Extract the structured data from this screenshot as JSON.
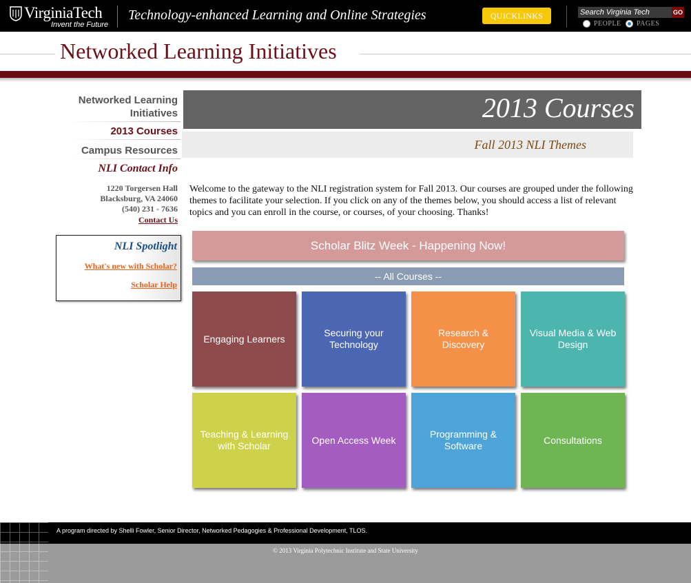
{
  "topbar": {
    "logo_text": "VirginiaTech",
    "logo_tagline": "Invent the Future",
    "site_title": "Technology-enhanced Learning and Online Strategies",
    "quicklinks_label": "QUICKLINKS",
    "search_placeholder": "Search Virginia Tech",
    "search_button": "GO",
    "radio_people": "PEOPLE",
    "radio_pages": "PAGES",
    "radio_selected": "PAGES"
  },
  "header": {
    "title": "Networked Learning Initiatives"
  },
  "sidebar": {
    "nav": [
      {
        "label_line1": "Networked Learning",
        "label_line2": "Initiatives",
        "color": "#555555"
      },
      {
        "label": "2013 Courses",
        "color": "#6a1018"
      },
      {
        "label": "Campus Resources",
        "color": "#555555"
      }
    ],
    "contact_heading": "NLI Contact Info",
    "address": [
      "1220 Torgersen Hall",
      "Blacksburg, VA 24060",
      "(540) 231 - 7636"
    ],
    "contact_link": "Contact Us",
    "spotlight": {
      "heading": "NLI Spotlight",
      "links": [
        "What's new with Scholar?",
        "Scholar Help"
      ]
    }
  },
  "main": {
    "banner_title": "2013 Courses",
    "subtitle": "Fall 2013 NLI Themes",
    "intro": "Welcome to the gateway to the NLI registration system for Fall 2013.  Our courses are grouped under the following themes to facilitate your selection.  If you click on any of the themes below, you should access a list of relevant topics and you can enroll in the course, or courses, of your choosing.  Thanks!",
    "blitz_label": "Scholar Blitz Week - Happening Now!",
    "all_courses_label": "-- All Courses --",
    "tiles": [
      {
        "label": "Engaging Learners",
        "color": "#8f4a4c"
      },
      {
        "label": "Securing your Technology",
        "color": "#4b66b3"
      },
      {
        "label": "Research & Discovery",
        "color": "#f59049"
      },
      {
        "label": "Visual Media & Web Design",
        "color": "#4cb5ae"
      },
      {
        "label": "Teaching & Learning with Scholar",
        "color": "#cdd24a"
      },
      {
        "label": "Open Access Week",
        "color": "#a35cc0"
      },
      {
        "label": "Programming & Software",
        "color": "#4ea3d8"
      },
      {
        "label": "Consultations",
        "color": "#6fb553"
      }
    ]
  },
  "footer": {
    "credit": "A program directed by Shelli Fowler, Senior Director, Networked Pedagogies & Professional Development, TLOS.",
    "copyright": "© 2013 Virginia Polytechnic Institute and State University"
  }
}
